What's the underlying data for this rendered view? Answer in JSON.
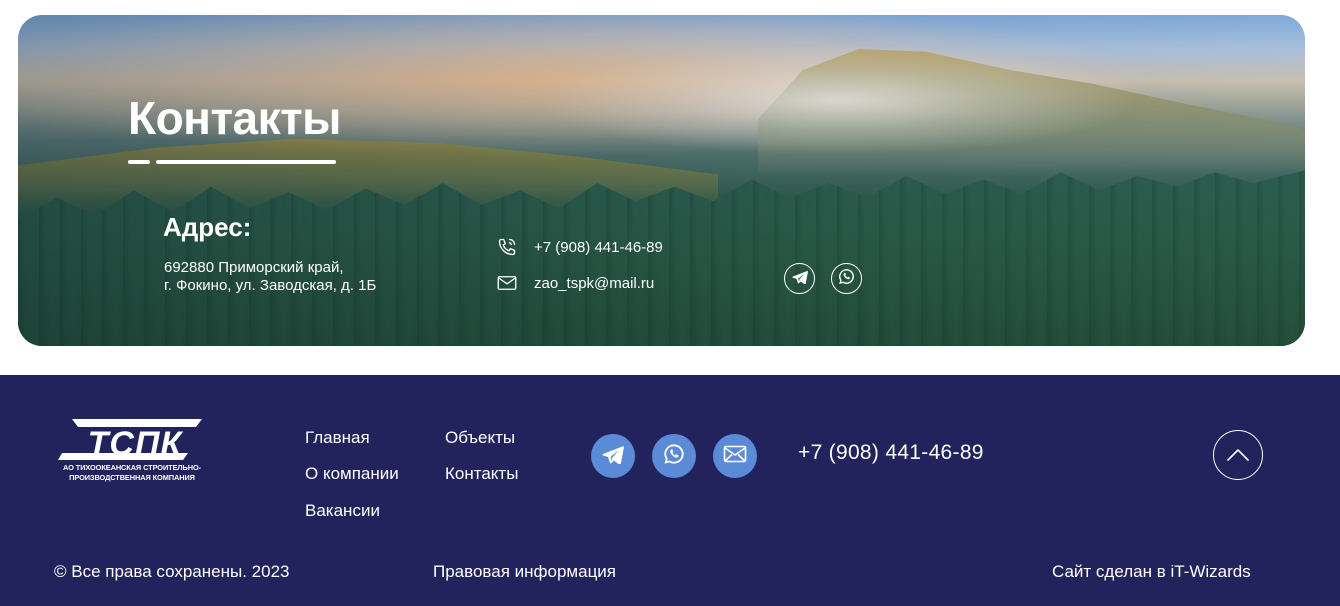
{
  "contacts": {
    "title": "Контакты",
    "address_heading": "Адрес:",
    "address_line1": "692880 Приморский край,",
    "address_line2": "г. Фокино, ул. Заводская, д. 1Б",
    "phone": "+7 (908) 441-46-89",
    "email": "zao_tspk@mail.ru",
    "icons": {
      "phone": "phone-icon",
      "email": "envelope-icon",
      "telegram": "telegram-icon",
      "whatsapp": "whatsapp-icon"
    }
  },
  "footer": {
    "logo_mark": "ТСПК",
    "logo_caption_line1": "АО ТИХООКЕАНСКАЯ СТРОИТЕЛЬНО-",
    "logo_caption_line2": "ПРОИЗВОДСТВЕННАЯ КОМПАНИЯ",
    "nav": {
      "main": "Главная",
      "about": "О компании",
      "jobs": "Вакансии",
      "objects": "Объекты",
      "contacts": "Контакты"
    },
    "phone": "+7 (908) 441-46-89",
    "copyright": "© Все права сохранены. 2023",
    "legal": "Правовая информация",
    "made_by": "Сайт сделан в iT-Wizards",
    "social_icons": [
      "telegram-icon",
      "whatsapp-icon",
      "envelope-icon"
    ],
    "scroll_icon": "chevron-up-icon"
  },
  "colors": {
    "footer_bg": "#22235d",
    "social_bg": "#5b8bd7",
    "text": "#ffffff"
  }
}
